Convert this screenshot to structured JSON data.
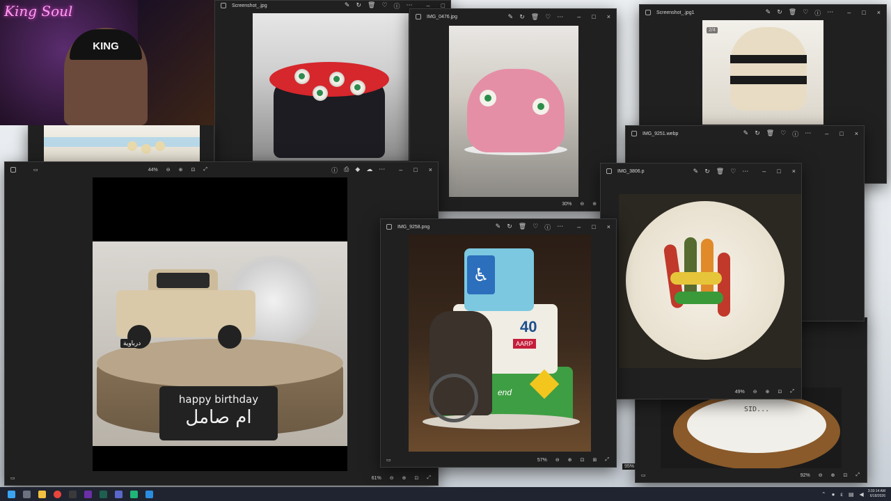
{
  "streamer": {
    "neon_sign": "King Soul",
    "hat_text": "KING"
  },
  "windows": {
    "eyeball_cake": {
      "filename": "Screenshot_.jpg"
    },
    "pink_cake": {
      "filename": "IMG_0476.jpg",
      "zoom": "30%"
    },
    "money_cake": {
      "filename": "Screenshot_.jpg1",
      "counter": "2/4"
    },
    "webp_window": {
      "filename": "IMG_9251.webp"
    },
    "jelly_fingers": {
      "filename": "IMG_3806.p",
      "zoom": "49%"
    },
    "car_cake": {
      "zoom_top": "44%",
      "zoom": "61%",
      "plaque_line1": "happy birthday",
      "plaque_line2": "ام صامل",
      "arabic_plate": "درباوية"
    },
    "old_lady_cake": {
      "filename": "IMG_9258.png",
      "zoom": "57%",
      "cake_number": "40",
      "badge_text": "AARP",
      "banner_text": "end"
    },
    "sid_cake": {
      "zoom": "92%",
      "cake_text": "SID..."
    },
    "behind_zoom": "95%"
  },
  "window_controls": {
    "minimize": "–",
    "maximize": "□",
    "close": "×"
  },
  "taskbar": {
    "clock_time": "3:33:14 AM",
    "clock_date": "6/18/2026",
    "tray_lang": "ε"
  }
}
